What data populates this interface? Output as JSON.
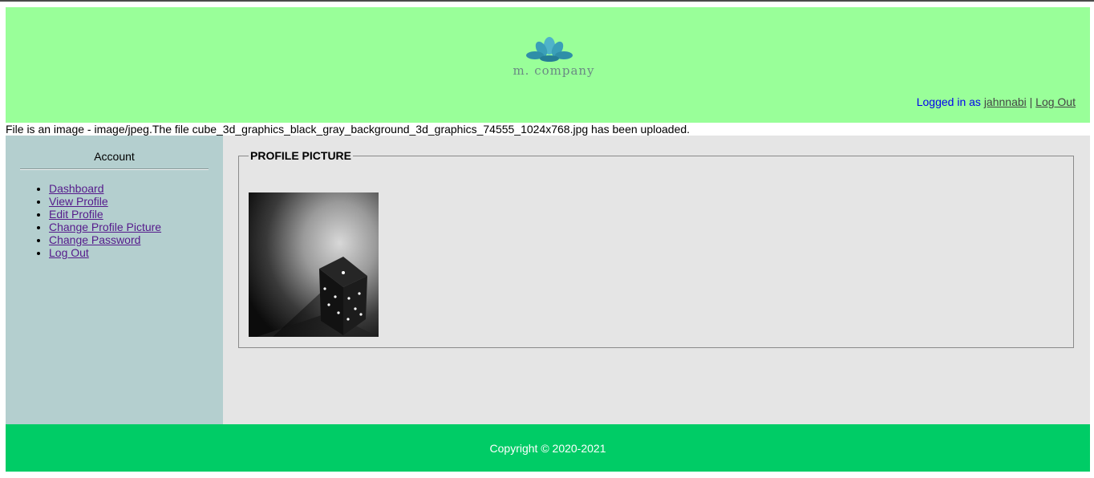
{
  "header": {
    "brand_name": "m. company",
    "logged_in_prefix": "Logged in as",
    "username": "jahnnabi",
    "separator": "|",
    "logout_label": "Log Out",
    "logo_icon": "lotus-icon",
    "background_color": "#99ff99"
  },
  "upload_message": "File is an image - image/jpeg.The file cube_3d_graphics_black_gray_background_3d_graphics_74555_1024x768.jpg has been uploaded.",
  "sidebar": {
    "title": "Account",
    "items": [
      {
        "label": "Dashboard"
      },
      {
        "label": "View Profile"
      },
      {
        "label": "Edit Profile"
      },
      {
        "label": "Change Profile Picture"
      },
      {
        "label": "Change Password"
      },
      {
        "label": "Log Out"
      }
    ],
    "background_color": "#b4cfcf"
  },
  "main": {
    "section_title": "PROFILE PICTURE",
    "image_alt": "3D cube on black gray background"
  },
  "footer": {
    "copyright": "Copyright © 2020-2021",
    "background_color": "#00cc66"
  }
}
